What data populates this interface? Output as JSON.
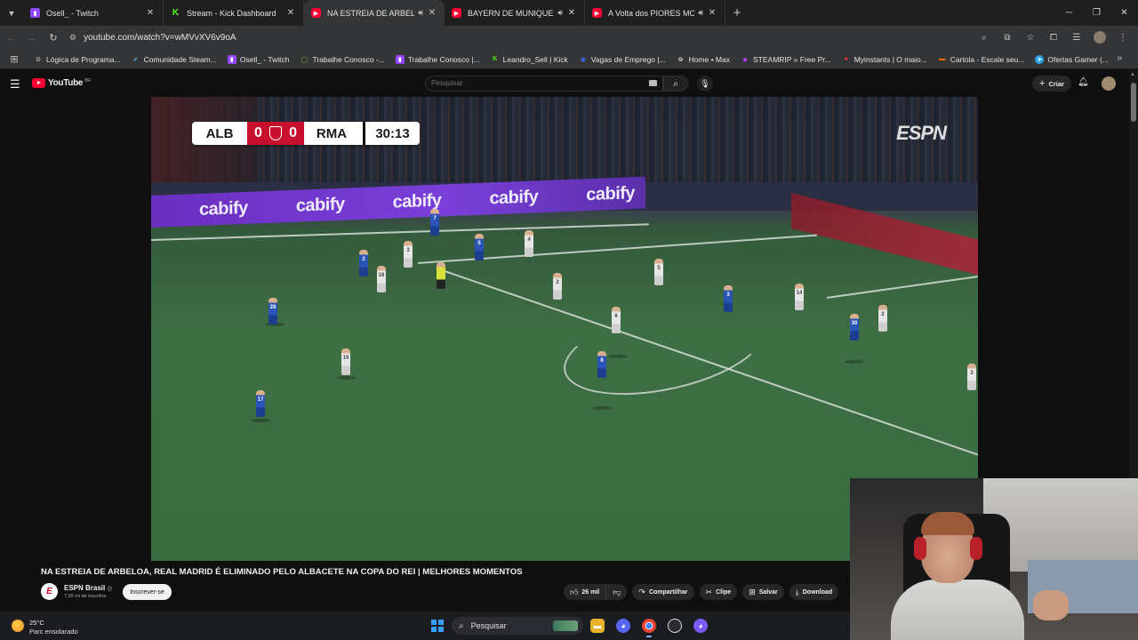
{
  "browser": {
    "tabs": [
      {
        "title": "Osell_ - Twitch",
        "favicon": "twitch-icon",
        "active": false,
        "audio": false
      },
      {
        "title": "Stream - Kick Dashboard",
        "favicon": "kick-icon",
        "active": false,
        "audio": false
      },
      {
        "title": "NA ESTREIA DE ARBELOA, R",
        "favicon": "youtube-icon",
        "active": true,
        "audio": true
      },
      {
        "title": "BAYERN DE MUNIQUE SAI ATRÁ",
        "favicon": "youtube-icon",
        "active": false,
        "audio": true
      },
      {
        "title": "A Volta dos PIORES MOMEN",
        "favicon": "youtube-icon",
        "active": false,
        "audio": true
      }
    ],
    "url": "youtube.com/watch?v=wMVvXV6v9oA",
    "bookmarks": [
      {
        "label": "Lógica de Programa...",
        "icon": "gear-icon",
        "color": "#bbbbbb"
      },
      {
        "label": "Comunidade Steam...",
        "icon": "steam-icon",
        "color": "#66c0f4"
      },
      {
        "label": "Osell_ - Twitch",
        "icon": "twitch-icon",
        "color": "#9146ff"
      },
      {
        "label": "Trabalhe Conosco -...",
        "icon": "circle-icon",
        "color": "#7fbf3f"
      },
      {
        "label": "Trabalhe Conosco |...",
        "icon": "twitch-icon",
        "color": "#9146ff"
      },
      {
        "label": "Leandro_Sell | Kick",
        "icon": "kick-icon",
        "color": "#53fc18"
      },
      {
        "label": "Vagas de Emprego |...",
        "icon": "circle-icon",
        "color": "#4a6cff"
      },
      {
        "label": "Home • Max",
        "icon": "max-icon",
        "color": "#ffffff"
      },
      {
        "label": "STEAMRIP » Free Pr...",
        "icon": "steamrip-icon",
        "color": "#b03cff"
      },
      {
        "label": "Myinstants | O maio...",
        "icon": "myinstants-icon",
        "color": "#ff3333"
      },
      {
        "label": "Cartola - Escale seu...",
        "icon": "cartola-icon",
        "color": "#ff6a00"
      },
      {
        "label": "Ofertas Gamer (...",
        "icon": "telegram-icon",
        "color": "#2aa3e0"
      }
    ]
  },
  "youtube": {
    "logo": "YouTube",
    "country": "BR",
    "search_placeholder": "Pesquisar",
    "create_label": "Criar"
  },
  "video": {
    "scorebug": {
      "home": "ALB",
      "home_score": "0",
      "away_score": "0",
      "away": "RMA",
      "clock": "30:13"
    },
    "broadcaster": "ESPN",
    "ad_board": "cabify",
    "title": "NA ESTREIA DE ARBELOA, REAL MADRID É ELIMINADO PELO ALBACETE NA COPA DO REI | MELHORES MOMENTOS",
    "channel": "ESPN Brasil",
    "subscribers": "7,59 mi de inscritos",
    "subscribe_label": "Inscrever-se",
    "likes": "26 mil",
    "share_label": "Compartilhar",
    "clip_label": "Clipe",
    "save_label": "Salvar",
    "download_label": "Download"
  },
  "taskbar": {
    "temperature": "25°C",
    "weather": "Parc ensolarado",
    "search_label": "Pesquisar"
  }
}
